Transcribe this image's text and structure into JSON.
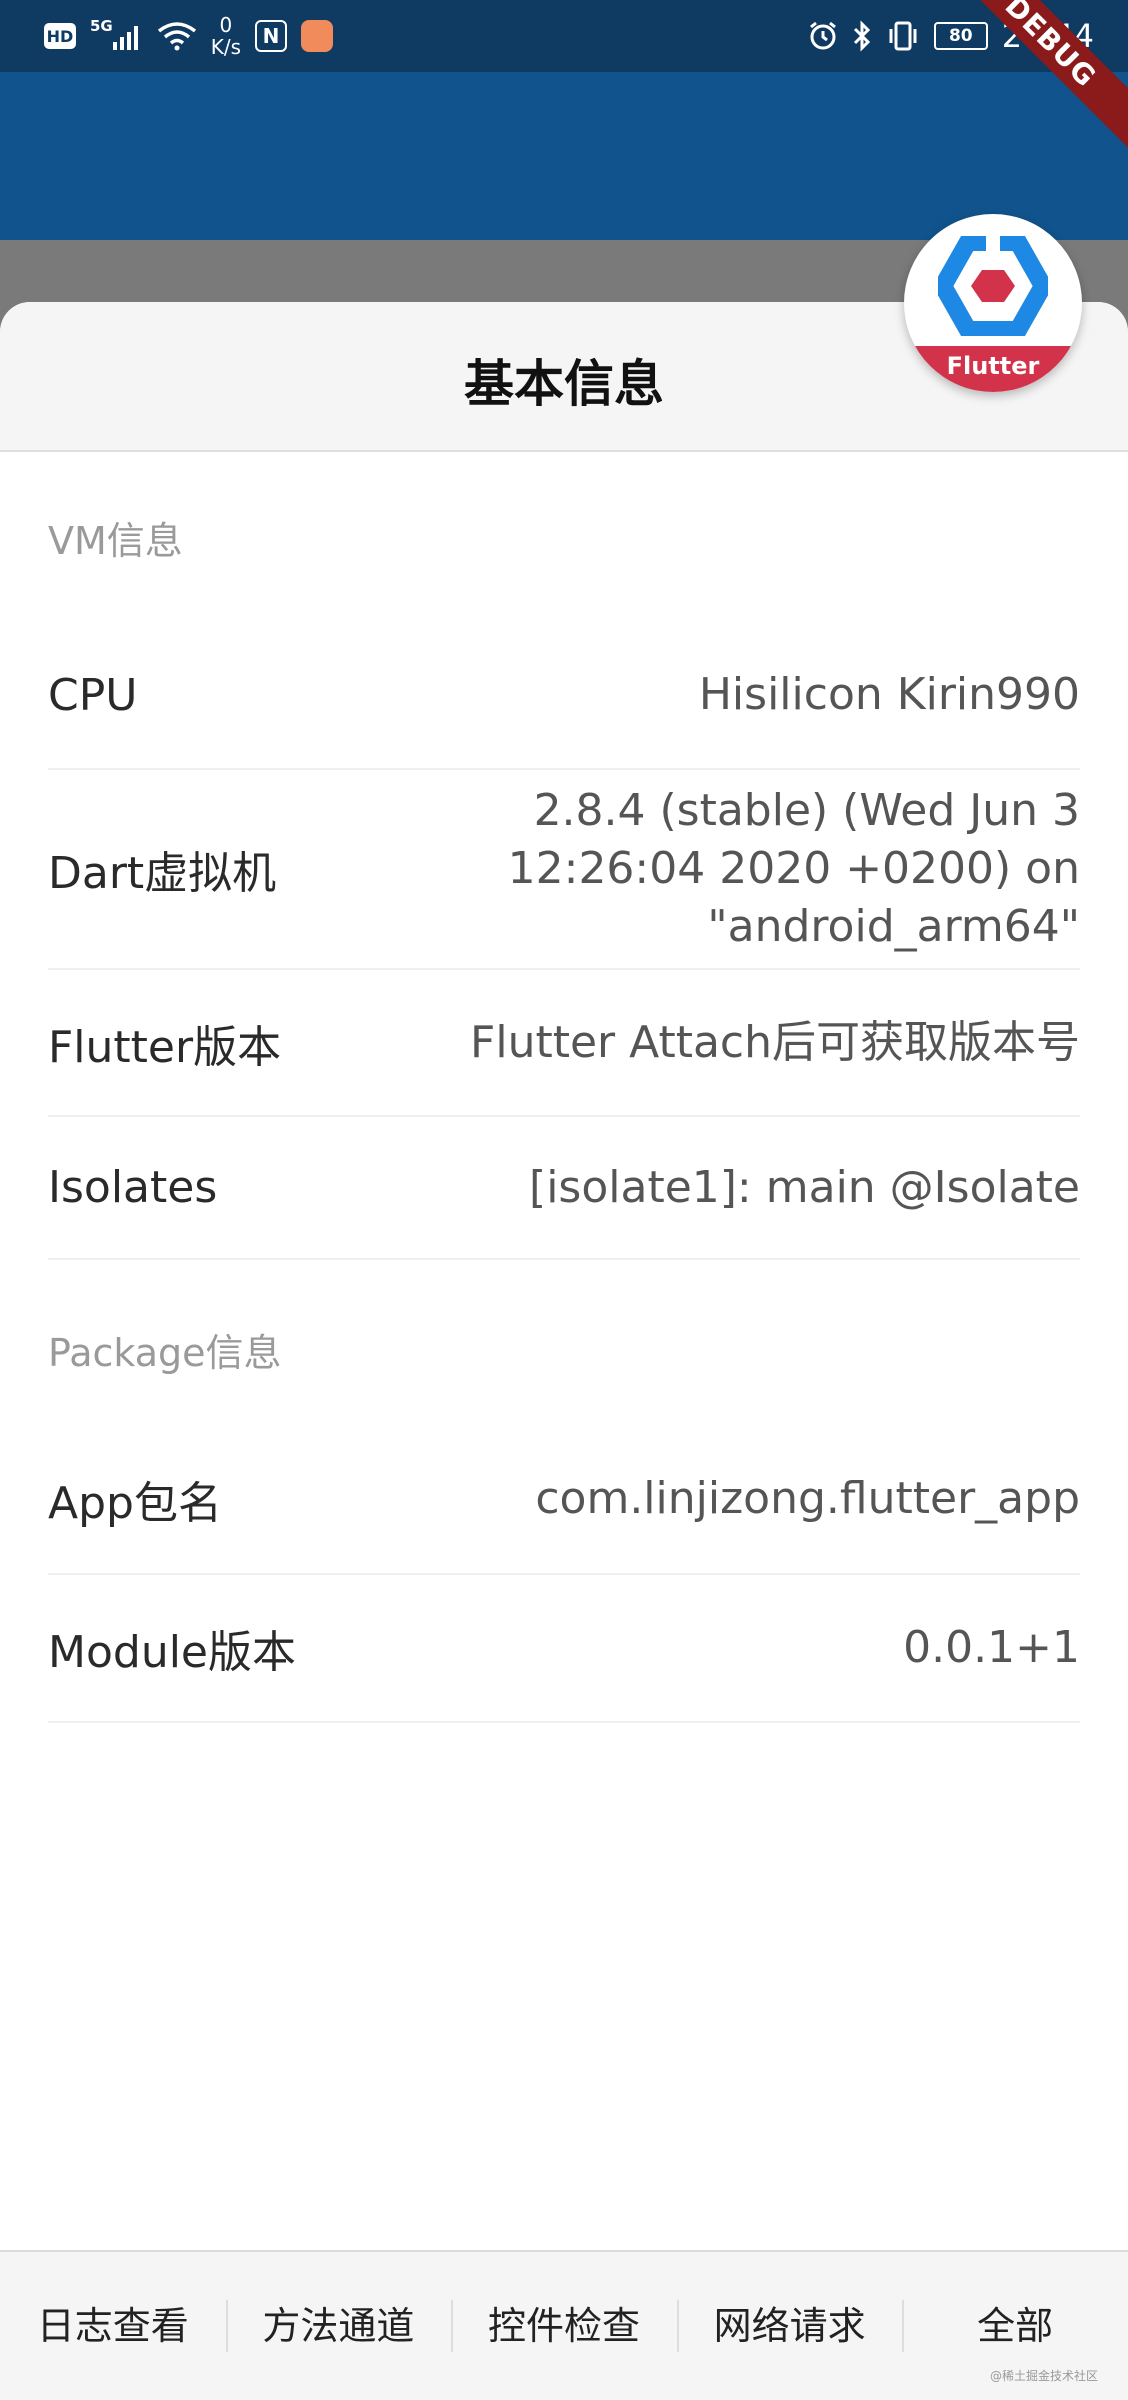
{
  "status_bar": {
    "hd_label": "HD",
    "network_label": "5G",
    "speed_value": "0",
    "speed_unit": "K/s",
    "nfc_label": "N",
    "battery_level": "80",
    "time": "20:44"
  },
  "debug_banner": "DEBUG",
  "flutter_badge_label": "Flutter",
  "sheet": {
    "title": "基本信息",
    "sections": [
      {
        "title": "VM信息",
        "rows": [
          {
            "label": "CPU",
            "value": "Hisilicon Kirin990"
          },
          {
            "label": "Dart虚拟机",
            "value": "2.8.4 (stable) (Wed Jun 3 12:26:04 2020 +0200) on \"android_arm64\""
          },
          {
            "label": "Flutter版本",
            "value": "Flutter Attach后可获取版本号"
          },
          {
            "label": "Isolates",
            "value": "[isolate1]: main @Isolate"
          }
        ]
      },
      {
        "title": "Package信息",
        "rows": [
          {
            "label": "App包名",
            "value": "com.linjizong.flutter_app"
          },
          {
            "label": "Module版本",
            "value": "0.0.1+1"
          }
        ]
      }
    ]
  },
  "tabs": [
    "日志查看",
    "方法通道",
    "控件检查",
    "网络请求",
    "全部"
  ],
  "watermark": "@稀土掘金技术社区",
  "colors": {
    "status_bar": "#0f3a61",
    "app_bar": "#11538c",
    "debug_ribbon": "#8b1a1a",
    "badge_band": "#d2324a",
    "badge_blue": "#1e88e5"
  }
}
